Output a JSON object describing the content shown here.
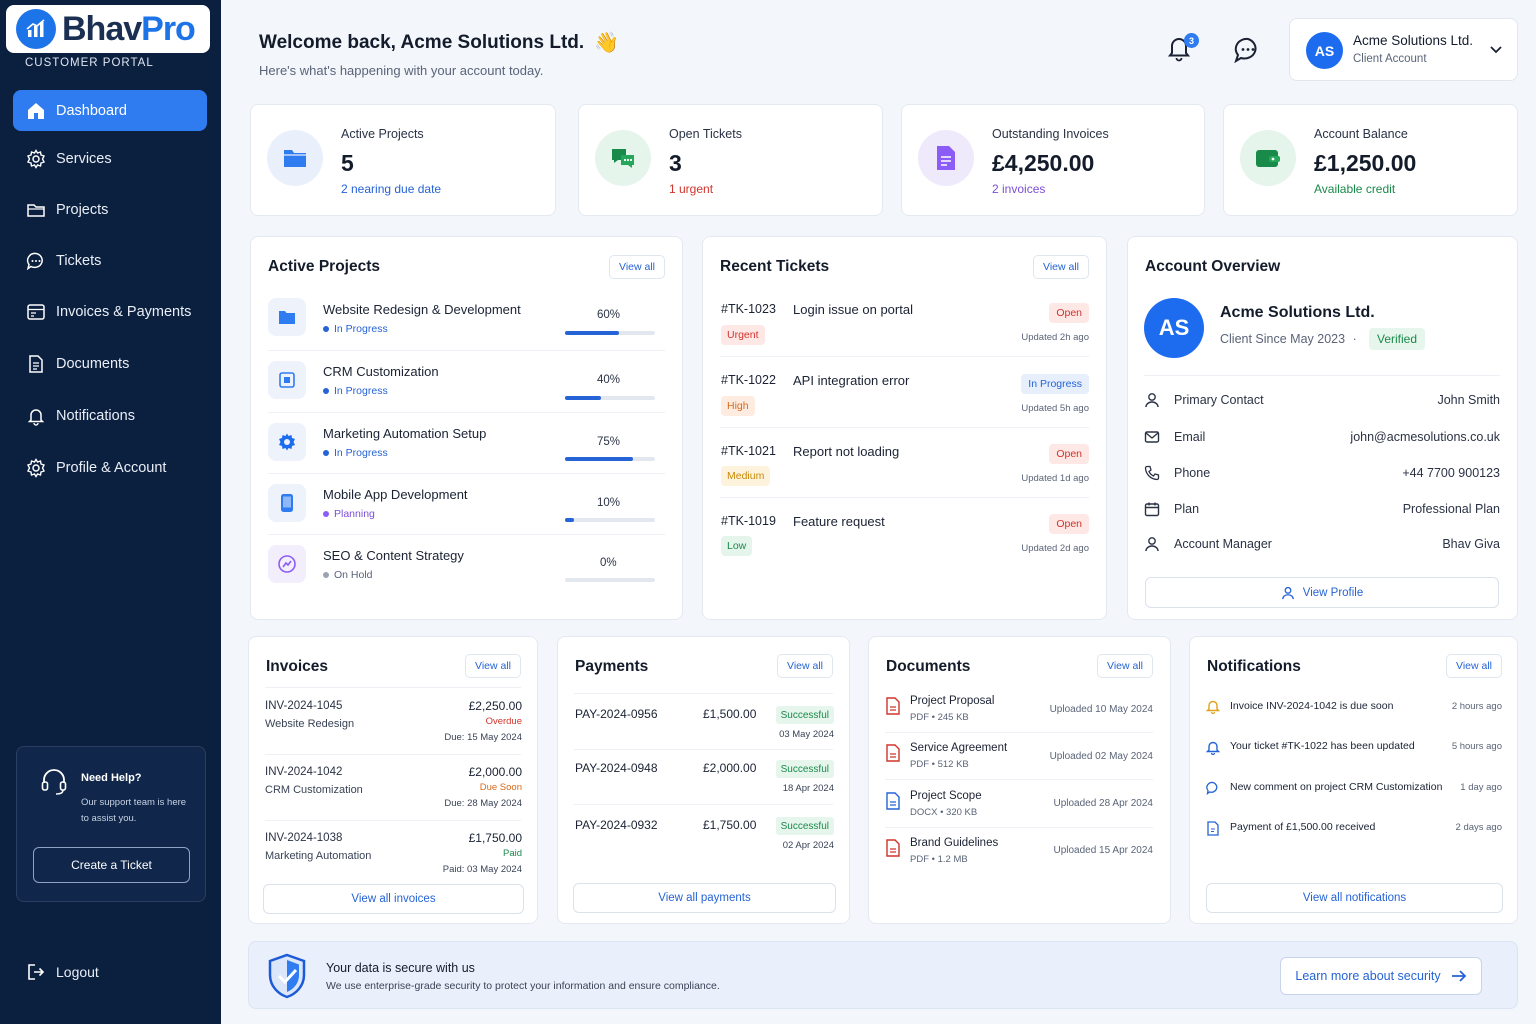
{
  "brand": {
    "name_part1": "Bhav",
    "name_part2": "Pro",
    "portal_label": "CUSTOMER PORTAL"
  },
  "sidebar": {
    "items": [
      {
        "label": "Dashboard",
        "icon": "home-icon",
        "active": true
      },
      {
        "label": "Services",
        "icon": "gear-icon"
      },
      {
        "label": "Projects",
        "icon": "folder-icon"
      },
      {
        "label": "Tickets",
        "icon": "chat-icon"
      },
      {
        "label": "Invoices & Payments",
        "icon": "invoice-icon"
      },
      {
        "label": "Documents",
        "icon": "document-icon"
      },
      {
        "label": "Notifications",
        "icon": "bell-icon"
      },
      {
        "label": "Profile & Account",
        "icon": "gear-icon"
      }
    ],
    "help": {
      "title": "Need Help?",
      "subtitle": "Our support team is here to assist you.",
      "button": "Create a Ticket"
    },
    "logout": "Logout"
  },
  "header": {
    "welcome": "Welcome back, Acme Solutions Ltd.",
    "wave": "👋",
    "subtitle": "Here's what's happening with your account today.",
    "notification_count": "3",
    "user": {
      "initials": "AS",
      "name": "Acme Solutions Ltd.",
      "role": "Client Account"
    }
  },
  "stats": [
    {
      "label": "Active Projects",
      "value": "5",
      "sub": "2 nearing due date",
      "icon": "folder-icon",
      "color": "#2563d6"
    },
    {
      "label": "Open Tickets",
      "value": "3",
      "sub": "1 urgent",
      "icon": "tickets-icon",
      "color": "#d0342c"
    },
    {
      "label": "Outstanding Invoices",
      "value": "£4,250.00",
      "sub": "2 invoices",
      "icon": "invoice-icon",
      "color": "#7b4fd6"
    },
    {
      "label": "Account Balance",
      "value": "£1,250.00",
      "sub": "Available credit",
      "icon": "wallet-icon",
      "color": "#1a8a4a"
    }
  ],
  "active_projects": {
    "title": "Active Projects",
    "view_all": "View all",
    "items": [
      {
        "name": "Website Redesign & Development",
        "status": "In Progress",
        "percent_label": "60%",
        "progress": 0.6
      },
      {
        "name": "CRM Customization",
        "status": "In Progress",
        "percent_label": "40%",
        "progress": 0.4
      },
      {
        "name": "Marketing Automation Setup",
        "status": "In Progress",
        "percent_label": "75%",
        "progress": 0.75
      },
      {
        "name": "Mobile App Development",
        "status": "Planning",
        "percent_label": "10%",
        "progress": 0.1
      },
      {
        "name": "SEO & Content Strategy",
        "status": "On Hold",
        "percent_label": "0%",
        "progress": 0.0
      }
    ]
  },
  "recent_tickets": {
    "title": "Recent Tickets",
    "view_all": "View all",
    "items": [
      {
        "id": "#TK-1023",
        "title": "Login issue on portal",
        "priority": "Urgent",
        "status": "Open",
        "updated": "Updated 2h ago"
      },
      {
        "id": "#TK-1022",
        "title": "API integration error",
        "priority": "High",
        "status": "In Progress",
        "updated": "Updated 5h ago"
      },
      {
        "id": "#TK-1021",
        "title": "Report not loading",
        "priority": "Medium",
        "status": "Open",
        "updated": "Updated 1d ago"
      },
      {
        "id": "#TK-1019",
        "title": "Feature request",
        "priority": "Low",
        "status": "Open",
        "updated": "Updated 2d ago"
      }
    ]
  },
  "account_overview": {
    "title": "Account Overview",
    "initials": "AS",
    "name": "Acme Solutions Ltd.",
    "since": "Client Since May 2023",
    "separator": "·",
    "verified": "Verified",
    "rows": [
      {
        "label": "Primary Contact",
        "value": "John Smith"
      },
      {
        "label": "Email",
        "value": "john@acmesolutions.co.uk"
      },
      {
        "label": "Phone",
        "value": "+44 7700 900123"
      },
      {
        "label": "Plan",
        "value": "Professional Plan"
      },
      {
        "label": "Account Manager",
        "value": "Bhav Giva"
      }
    ],
    "button": "View Profile"
  },
  "invoices": {
    "title": "Invoices",
    "view_all": "View all",
    "items": [
      {
        "id": "INV-2024-1045",
        "desc": "Website Redesign",
        "amount": "£2,250.00",
        "status": "Overdue",
        "date": "Due: 15 May 2024"
      },
      {
        "id": "INV-2024-1042",
        "desc": "CRM Customization",
        "amount": "£2,000.00",
        "status": "Due Soon",
        "date": "Due: 28 May 2024"
      },
      {
        "id": "INV-2024-1038",
        "desc": "Marketing Automation",
        "amount": "£1,750.00",
        "status": "Paid",
        "date": "Paid: 03 May 2024"
      }
    ],
    "footer": "View all invoices"
  },
  "payments": {
    "title": "Payments",
    "view_all": "View all",
    "items": [
      {
        "id": "PAY-2024-0956",
        "amount": "£1,500.00",
        "status": "Successful",
        "date": "03 May 2024"
      },
      {
        "id": "PAY-2024-0948",
        "amount": "£2,000.00",
        "status": "Successful",
        "date": "18 Apr 2024"
      },
      {
        "id": "PAY-2024-0932",
        "amount": "£1,750.00",
        "status": "Successful",
        "date": "02 Apr 2024"
      }
    ],
    "footer": "View all payments"
  },
  "documents": {
    "title": "Documents",
    "view_all": "View all",
    "items": [
      {
        "name": "Project Proposal",
        "meta": "PDF • 245 KB",
        "uploaded": "Uploaded 10 May 2024",
        "color": "#d0342c"
      },
      {
        "name": "Service Agreement",
        "meta": "PDF • 512 KB",
        "uploaded": "Uploaded 02 May 2024",
        "color": "#d0342c"
      },
      {
        "name": "Project Scope",
        "meta": "DOCX • 320 KB",
        "uploaded": "Uploaded 28 Apr 2024",
        "color": "#2563d6"
      },
      {
        "name": "Brand Guidelines",
        "meta": "PDF • 1.2 MB",
        "uploaded": "Uploaded 15 Apr 2024",
        "color": "#d0342c"
      }
    ]
  },
  "notifications": {
    "title": "Notifications",
    "view_all": "View all",
    "items": [
      {
        "text": "Invoice INV-2024-1042 is due soon",
        "time": "2 hours ago",
        "icon": "bell-icon",
        "color": "#e0a21a"
      },
      {
        "text": "Your ticket #TK-1022 has been updated",
        "time": "5 hours ago",
        "icon": "bell-icon",
        "color": "#2563d6"
      },
      {
        "text": "New comment on project CRM Customization",
        "time": "1 day ago",
        "icon": "comment-icon",
        "color": "#2563d6"
      },
      {
        "text": "Payment of £1,500.00 received",
        "time": "2 days ago",
        "icon": "payment-icon",
        "color": "#2563d6"
      }
    ],
    "footer": "View all notifications"
  },
  "security": {
    "title": "Your data is secure with us",
    "subtitle": "We use enterprise-grade security to protect your information and ensure compliance.",
    "button": "Learn more about security"
  }
}
